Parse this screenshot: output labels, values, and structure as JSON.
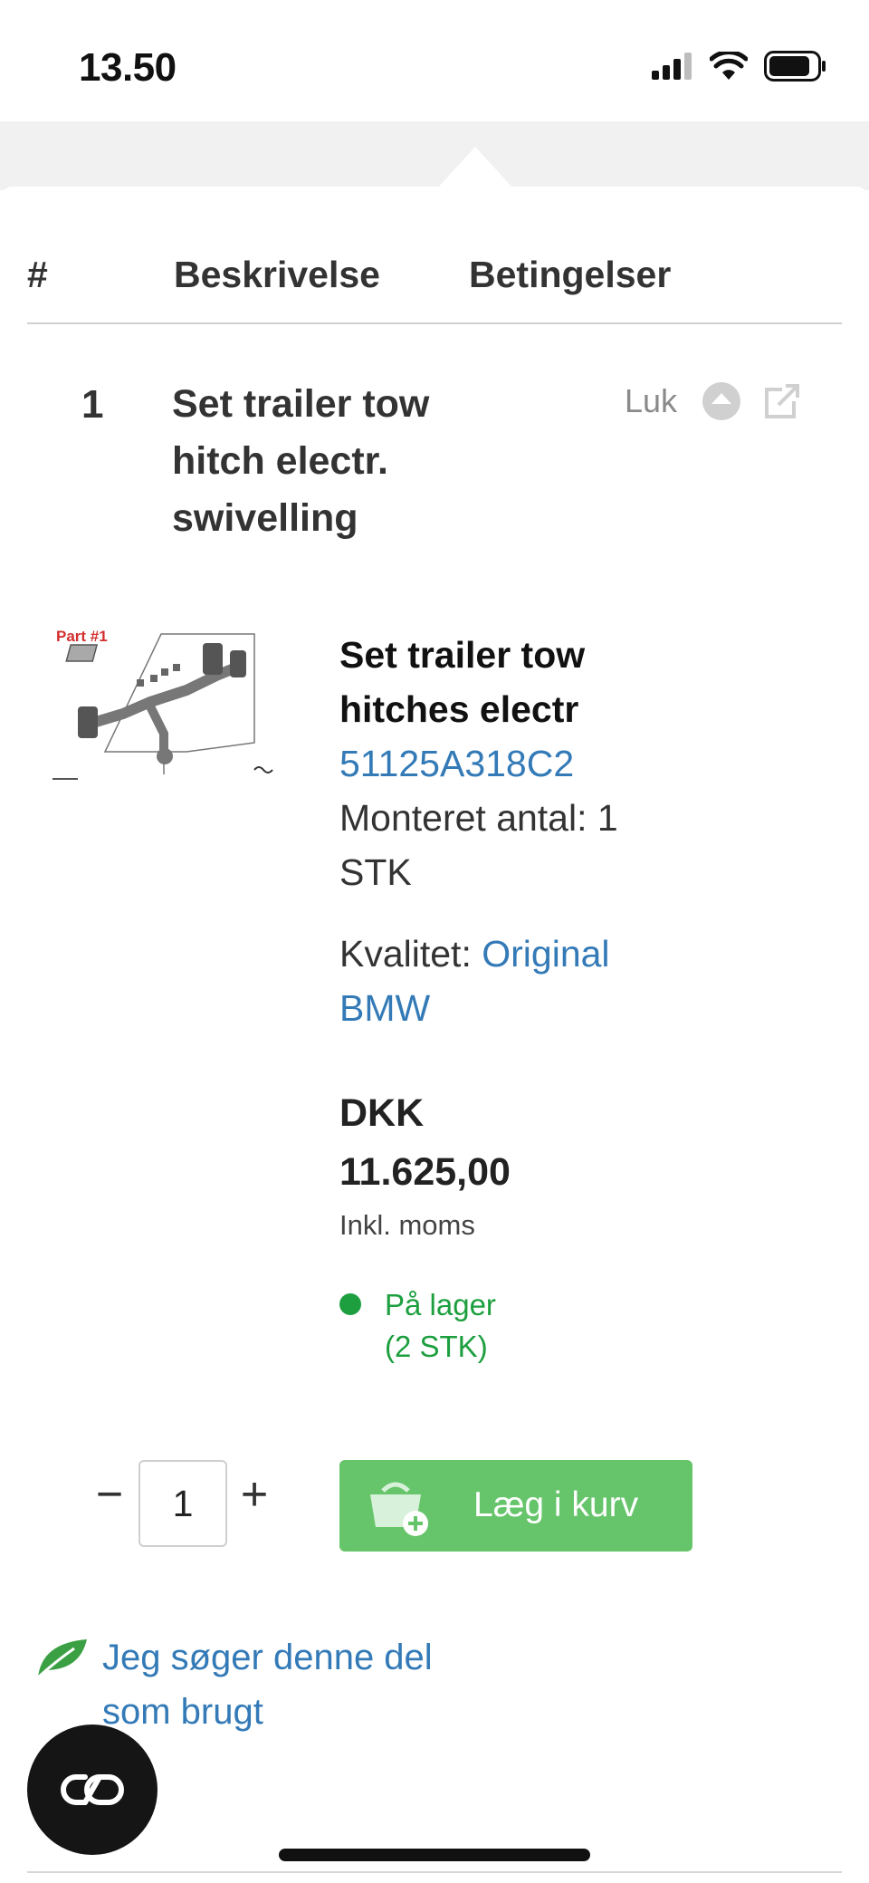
{
  "status_bar": {
    "time": "13.50",
    "icons": [
      "cellular-signal-icon",
      "wifi-icon",
      "battery-icon"
    ]
  },
  "table": {
    "headers": {
      "num": "#",
      "description": "Beskrivelse",
      "conditions": "Betingelser"
    }
  },
  "row": {
    "number": "1",
    "title": "Set trailer tow hitch electr. swivelling",
    "close_label": "Luk",
    "icons": [
      "collapse-up-icon",
      "external-link-icon"
    ]
  },
  "product": {
    "image_label": "Part #1",
    "name": "Set trailer tow hitches electr",
    "part_number": "51125A318C2",
    "mounted_qty": "Monteret antal: 1 STK",
    "quality_label": "Kvalitet:",
    "quality_value": "Original BMW",
    "price_currency": "DKK",
    "price_value": "11.625,00",
    "price_note": "Inkl. moms",
    "stock_text": "På lager (2 STK)"
  },
  "cart": {
    "minus": "−",
    "quantity": "1",
    "plus": "+",
    "add_label": "Læg i kurv"
  },
  "used_search": {
    "label": "Jeg søger denne del som brugt"
  },
  "colors": {
    "link": "#337ab7",
    "stock_green": "#1d9f3f",
    "cart_button": "#66c56b",
    "fab": "#151515"
  }
}
